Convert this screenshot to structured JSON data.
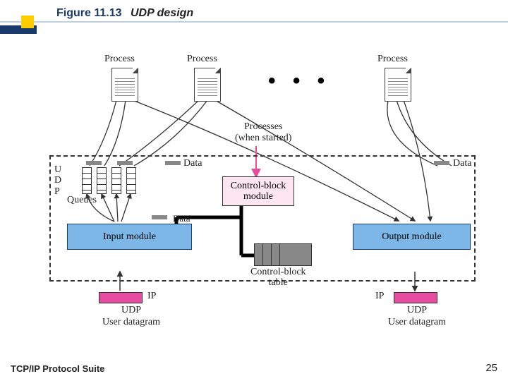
{
  "header": {
    "figure_number": "Figure 11.13",
    "figure_title": "UDP design"
  },
  "labels": {
    "process": "Process",
    "udp_side": "U\nD\nP",
    "queues": "Queues",
    "data": "Data",
    "processes_started": "Processes\n(when started)",
    "control_block_module": "Control-block\nmodule",
    "input_module": "Input module",
    "output_module": "Output module",
    "control_block_table": "Control-block\ntable",
    "ip": "IP",
    "udp_user_datagram": "UDP\nUser datagram"
  },
  "footer": {
    "left": "TCP/IP Protocol Suite",
    "page": "25"
  }
}
